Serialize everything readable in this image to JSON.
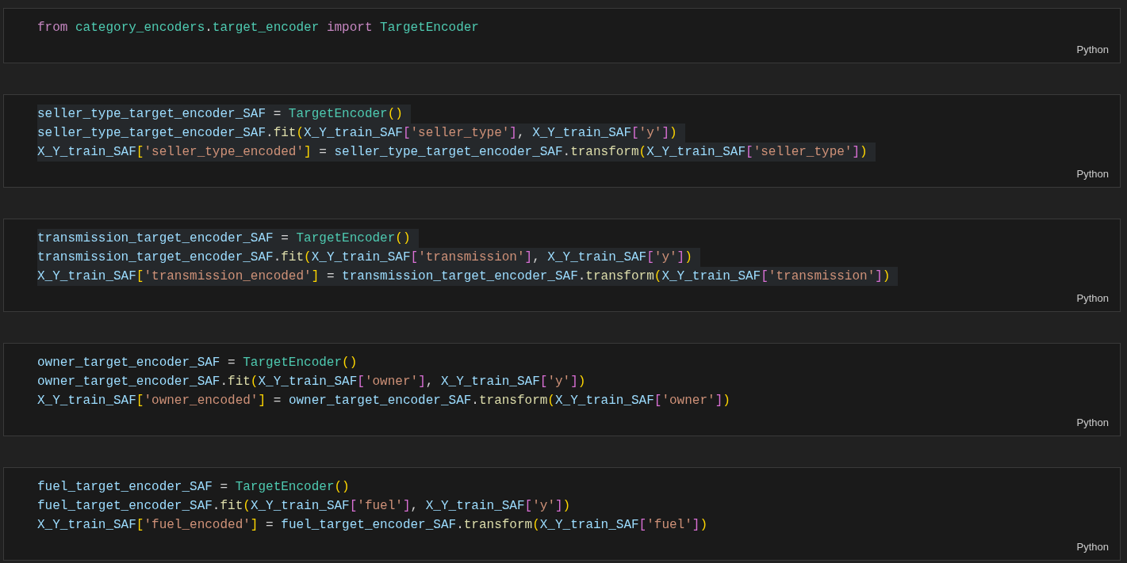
{
  "cells": [
    {
      "language": "Python",
      "lines": [
        {
          "selected": false,
          "tokens": [
            {
              "kind": "keyword",
              "text": "from "
            },
            {
              "kind": "type",
              "text": "category_encoders"
            },
            {
              "kind": "plain",
              "text": "."
            },
            {
              "kind": "type",
              "text": "target_encoder "
            },
            {
              "kind": "keyword",
              "text": "import "
            },
            {
              "kind": "type",
              "text": "TargetEncoder"
            }
          ]
        }
      ]
    },
    {
      "language": "Python",
      "lines": [
        {
          "selected": true,
          "tokens": [
            {
              "kind": "variable",
              "text": "seller_type_target_encoder_SAF"
            },
            {
              "kind": "plain",
              "text": " = "
            },
            {
              "kind": "type",
              "text": "TargetEncoder"
            },
            {
              "kind": "bracket1",
              "text": "()"
            }
          ]
        },
        {
          "selected": true,
          "tokens": [
            {
              "kind": "variable",
              "text": "seller_type_target_encoder_SAF"
            },
            {
              "kind": "plain",
              "text": "."
            },
            {
              "kind": "function",
              "text": "fit"
            },
            {
              "kind": "bracket1",
              "text": "("
            },
            {
              "kind": "variable",
              "text": "X_Y_train_SAF"
            },
            {
              "kind": "bracket2",
              "text": "["
            },
            {
              "kind": "string",
              "text": "'seller_type'"
            },
            {
              "kind": "bracket2",
              "text": "]"
            },
            {
              "kind": "plain",
              "text": ", "
            },
            {
              "kind": "variable",
              "text": "X_Y_train_SAF"
            },
            {
              "kind": "bracket2",
              "text": "["
            },
            {
              "kind": "string",
              "text": "'y'"
            },
            {
              "kind": "bracket2",
              "text": "]"
            },
            {
              "kind": "bracket1",
              "text": ")"
            }
          ]
        },
        {
          "selected": true,
          "tokens": [
            {
              "kind": "variable",
              "text": "X_Y_train_SAF"
            },
            {
              "kind": "bracket1",
              "text": "["
            },
            {
              "kind": "string",
              "text": "'seller_type_encoded'"
            },
            {
              "kind": "bracket1",
              "text": "]"
            },
            {
              "kind": "plain",
              "text": " = "
            },
            {
              "kind": "variable",
              "text": "seller_type_target_encoder_SAF"
            },
            {
              "kind": "plain",
              "text": "."
            },
            {
              "kind": "function",
              "text": "transform"
            },
            {
              "kind": "bracket1",
              "text": "("
            },
            {
              "kind": "variable",
              "text": "X_Y_train_SAF"
            },
            {
              "kind": "bracket2",
              "text": "["
            },
            {
              "kind": "string",
              "text": "'seller_type'"
            },
            {
              "kind": "bracket2",
              "text": "]"
            },
            {
              "kind": "bracket1",
              "text": ")"
            }
          ]
        }
      ]
    },
    {
      "language": "Python",
      "lines": [
        {
          "selected": true,
          "tokens": [
            {
              "kind": "variable",
              "text": "transmission_target_encoder_SAF"
            },
            {
              "kind": "plain",
              "text": " = "
            },
            {
              "kind": "type",
              "text": "TargetEncoder"
            },
            {
              "kind": "bracket1",
              "text": "()"
            }
          ]
        },
        {
          "selected": true,
          "tokens": [
            {
              "kind": "variable",
              "text": "transmission_target_encoder_SAF"
            },
            {
              "kind": "plain",
              "text": "."
            },
            {
              "kind": "function",
              "text": "fit"
            },
            {
              "kind": "bracket1",
              "text": "("
            },
            {
              "kind": "variable",
              "text": "X_Y_train_SAF"
            },
            {
              "kind": "bracket2",
              "text": "["
            },
            {
              "kind": "string",
              "text": "'transmission'"
            },
            {
              "kind": "bracket2",
              "text": "]"
            },
            {
              "kind": "plain",
              "text": ", "
            },
            {
              "kind": "variable",
              "text": "X_Y_train_SAF"
            },
            {
              "kind": "bracket2",
              "text": "["
            },
            {
              "kind": "string",
              "text": "'y'"
            },
            {
              "kind": "bracket2",
              "text": "]"
            },
            {
              "kind": "bracket1",
              "text": ")"
            }
          ]
        },
        {
          "selected": true,
          "tokens": [
            {
              "kind": "variable",
              "text": "X_Y_train_SAF"
            },
            {
              "kind": "bracket1",
              "text": "["
            },
            {
              "kind": "string",
              "text": "'transmission_encoded'"
            },
            {
              "kind": "bracket1",
              "text": "]"
            },
            {
              "kind": "plain",
              "text": " = "
            },
            {
              "kind": "variable",
              "text": "transmission_target_encoder_SAF"
            },
            {
              "kind": "plain",
              "text": "."
            },
            {
              "kind": "function",
              "text": "transform"
            },
            {
              "kind": "bracket1",
              "text": "("
            },
            {
              "kind": "variable",
              "text": "X_Y_train_SAF"
            },
            {
              "kind": "bracket2",
              "text": "["
            },
            {
              "kind": "string",
              "text": "'transmission'"
            },
            {
              "kind": "bracket2",
              "text": "]"
            },
            {
              "kind": "bracket1",
              "text": ")"
            }
          ]
        }
      ]
    },
    {
      "language": "Python",
      "lines": [
        {
          "selected": false,
          "tokens": [
            {
              "kind": "variable",
              "text": "owner_target_encoder_SAF"
            },
            {
              "kind": "plain",
              "text": " = "
            },
            {
              "kind": "type",
              "text": "TargetEncoder"
            },
            {
              "kind": "bracket1",
              "text": "()"
            }
          ]
        },
        {
          "selected": false,
          "tokens": [
            {
              "kind": "variable",
              "text": "owner_target_encoder_SAF"
            },
            {
              "kind": "plain",
              "text": "."
            },
            {
              "kind": "function",
              "text": "fit"
            },
            {
              "kind": "bracket1",
              "text": "("
            },
            {
              "kind": "variable",
              "text": "X_Y_train_SAF"
            },
            {
              "kind": "bracket2",
              "text": "["
            },
            {
              "kind": "string",
              "text": "'owner'"
            },
            {
              "kind": "bracket2",
              "text": "]"
            },
            {
              "kind": "plain",
              "text": ", "
            },
            {
              "kind": "variable",
              "text": "X_Y_train_SAF"
            },
            {
              "kind": "bracket2",
              "text": "["
            },
            {
              "kind": "string",
              "text": "'y'"
            },
            {
              "kind": "bracket2",
              "text": "]"
            },
            {
              "kind": "bracket1",
              "text": ")"
            }
          ]
        },
        {
          "selected": false,
          "tokens": [
            {
              "kind": "variable",
              "text": "X_Y_train_SAF"
            },
            {
              "kind": "bracket1",
              "text": "["
            },
            {
              "kind": "string",
              "text": "'owner_encoded'"
            },
            {
              "kind": "bracket1",
              "text": "]"
            },
            {
              "kind": "plain",
              "text": " = "
            },
            {
              "kind": "variable",
              "text": "owner_target_encoder_SAF"
            },
            {
              "kind": "plain",
              "text": "."
            },
            {
              "kind": "function",
              "text": "transform"
            },
            {
              "kind": "bracket1",
              "text": "("
            },
            {
              "kind": "variable",
              "text": "X_Y_train_SAF"
            },
            {
              "kind": "bracket2",
              "text": "["
            },
            {
              "kind": "string",
              "text": "'owner'"
            },
            {
              "kind": "bracket2",
              "text": "]"
            },
            {
              "kind": "bracket1",
              "text": ")"
            }
          ]
        }
      ]
    },
    {
      "language": "Python",
      "lines": [
        {
          "selected": false,
          "tokens": [
            {
              "kind": "variable",
              "text": "fuel_target_encoder_SAF"
            },
            {
              "kind": "plain",
              "text": " = "
            },
            {
              "kind": "type",
              "text": "TargetEncoder"
            },
            {
              "kind": "bracket1",
              "text": "()"
            }
          ]
        },
        {
          "selected": false,
          "tokens": [
            {
              "kind": "variable",
              "text": "fuel_target_encoder_SAF"
            },
            {
              "kind": "plain",
              "text": "."
            },
            {
              "kind": "function",
              "text": "fit"
            },
            {
              "kind": "bracket1",
              "text": "("
            },
            {
              "kind": "variable",
              "text": "X_Y_train_SAF"
            },
            {
              "kind": "bracket2",
              "text": "["
            },
            {
              "kind": "string",
              "text": "'fuel'"
            },
            {
              "kind": "bracket2",
              "text": "]"
            },
            {
              "kind": "plain",
              "text": ", "
            },
            {
              "kind": "variable",
              "text": "X_Y_train_SAF"
            },
            {
              "kind": "bracket2",
              "text": "["
            },
            {
              "kind": "string",
              "text": "'y'"
            },
            {
              "kind": "bracket2",
              "text": "]"
            },
            {
              "kind": "bracket1",
              "text": ")"
            }
          ]
        },
        {
          "selected": false,
          "tokens": [
            {
              "kind": "variable",
              "text": "X_Y_train_SAF"
            },
            {
              "kind": "bracket1",
              "text": "["
            },
            {
              "kind": "string",
              "text": "'fuel_encoded'"
            },
            {
              "kind": "bracket1",
              "text": "]"
            },
            {
              "kind": "plain",
              "text": " = "
            },
            {
              "kind": "variable",
              "text": "fuel_target_encoder_SAF"
            },
            {
              "kind": "plain",
              "text": "."
            },
            {
              "kind": "function",
              "text": "transform"
            },
            {
              "kind": "bracket1",
              "text": "("
            },
            {
              "kind": "variable",
              "text": "X_Y_train_SAF"
            },
            {
              "kind": "bracket2",
              "text": "["
            },
            {
              "kind": "string",
              "text": "'fuel'"
            },
            {
              "kind": "bracket2",
              "text": "]"
            },
            {
              "kind": "bracket1",
              "text": ")"
            }
          ]
        }
      ]
    }
  ]
}
